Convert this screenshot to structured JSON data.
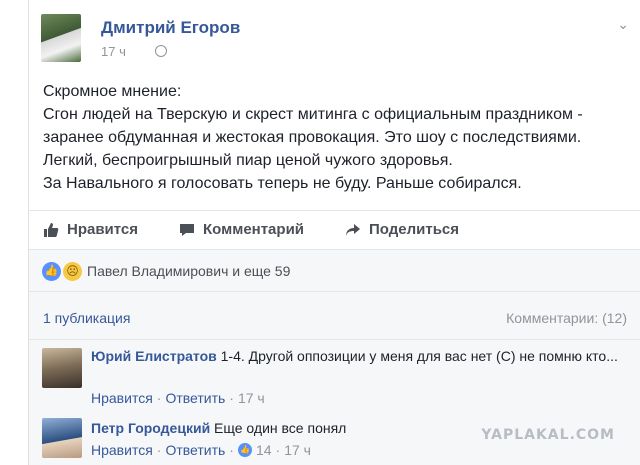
{
  "post": {
    "author": "Дмитрий Егоров",
    "time": "17 ч",
    "lines": [
      "Скромное мнение:",
      "Сгон людей на Тверскую и скрест митинга с официальным праздником -",
      "заранее обдуманная и жестокая провокация. Это шоу с последствиями.",
      "Легкий, беспроигрышный пиар ценой чужого здоровья.",
      "За Навального я голосовать теперь не буду. Раньше собирался."
    ]
  },
  "actions": {
    "like": "Нравится",
    "comment": "Комментарий",
    "share": "Поделиться"
  },
  "reactions": {
    "text": "Павел Владимирович и еще 59",
    "colors": {
      "like": "#5890ff",
      "sad": "#f7c846"
    }
  },
  "stats": {
    "shares": "1 публикация",
    "comments": "Комментарии: (12)"
  },
  "comments": [
    {
      "author": "Юрий Елистратов",
      "text": " 1-4. Другой оппозиции у меня для вас нет (С) не помню кто...",
      "like": "Нравится",
      "reply": "Ответить",
      "time": "17 ч"
    },
    {
      "author": "Петр Городецкий",
      "text": " Еще один все понял",
      "like": "Нравится",
      "reply": "Ответить",
      "likes_count": "14",
      "time": "17 ч"
    }
  ],
  "watermark": "YAPLAKAL.COM",
  "icons": {
    "globe": "globe-icon",
    "chevron": "chevron-down-icon",
    "like": "thumbs-up-icon",
    "comment": "comment-bubble-icon",
    "share": "share-arrow-icon"
  },
  "theme": {
    "link": "#365899",
    "muted": "#90949c",
    "text": "#1d2129"
  }
}
